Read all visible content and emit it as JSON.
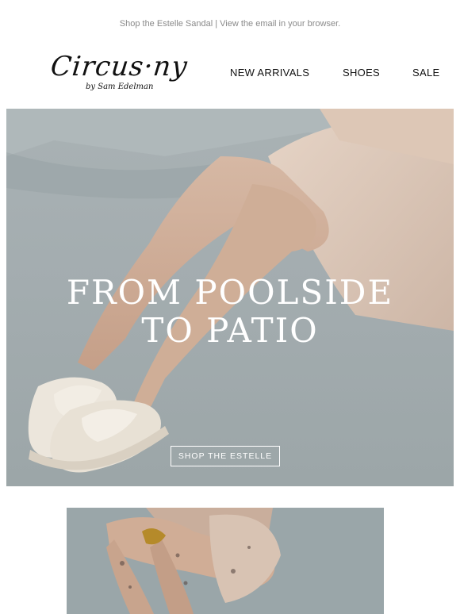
{
  "preheader": {
    "shop_link": "Shop the Estelle Sandal",
    "separator": " | ",
    "browser_link": "View the email in your browser."
  },
  "logo": {
    "main": "Circus·ny",
    "sub": "by Sam Edelman"
  },
  "nav": {
    "new_arrivals": "NEW ARRIVALS",
    "shoes": "SHOES",
    "sale": "SALE"
  },
  "hero": {
    "title_line1": "FROM POOLSIDE",
    "title_line2": "TO PATIO",
    "cta": "SHOP THE ESTELLE"
  },
  "colors": {
    "background": "#ffffff",
    "text": "#111111",
    "muted": "#8a8a8a",
    "hero_bg": "#a4adb0",
    "hero_text": "#ffffff"
  }
}
